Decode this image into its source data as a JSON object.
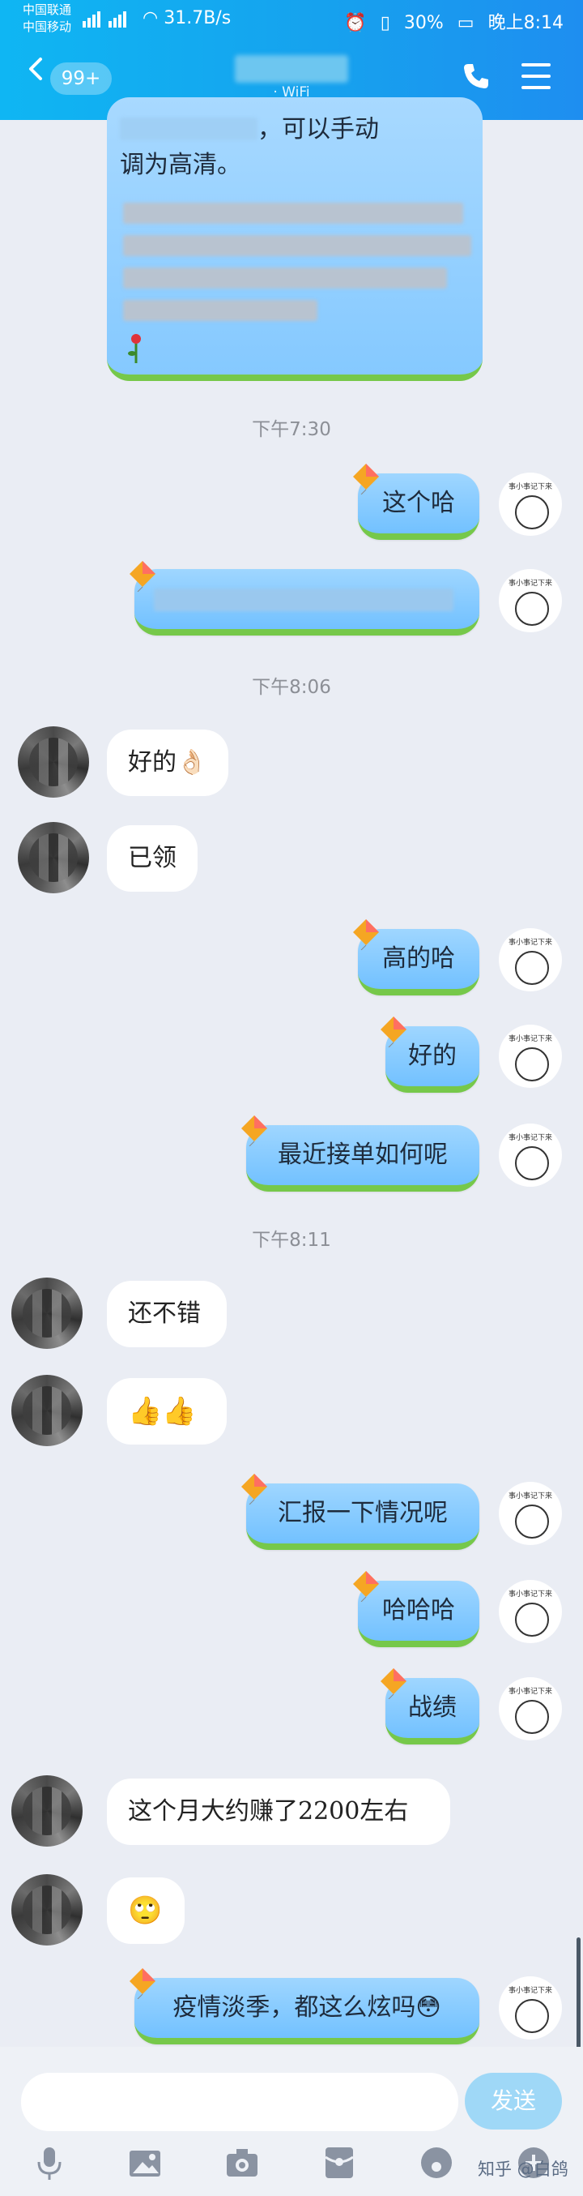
{
  "status_bar": {
    "carrier1": "中国联通",
    "carrier2": "中国移动",
    "net_speed": "31.7B/s",
    "battery": "30%",
    "time": "晚上8:14"
  },
  "header": {
    "unread_badge": "99+",
    "subtitle": "· WiFi"
  },
  "first_message": {
    "line1_suffix": "，可以手动",
    "line2": "调为高清。"
  },
  "timestamps": [
    "下午7:30",
    "下午8:06",
    "下午8:11"
  ],
  "messages": {
    "m1": "这个哈",
    "m2": "好的👌🏻",
    "m3": "已领",
    "m4": "高的哈",
    "m5": "好的",
    "m6": "最近接单如何呢",
    "m7": "还不错",
    "m8": "👍👍",
    "m9": "汇报一下情况呢",
    "m10": "哈哈哈",
    "m11": "战绩",
    "m12": "这个月大约赚了2200左右",
    "m13": "🙄",
    "m14": "疫情淡季，都这么炫吗😳"
  },
  "avatar_caption": "事小事记下来",
  "input": {
    "placeholder": "",
    "send_label": "发送"
  },
  "watermark": "知乎 @白鸽",
  "colors": {
    "header_start": "#0fb6f3",
    "header_end": "#1e8ef0",
    "bubble_out": "#88ccff",
    "bubble_in": "#ffffff",
    "grass": "#76c84a",
    "background": "#eaedf4"
  }
}
